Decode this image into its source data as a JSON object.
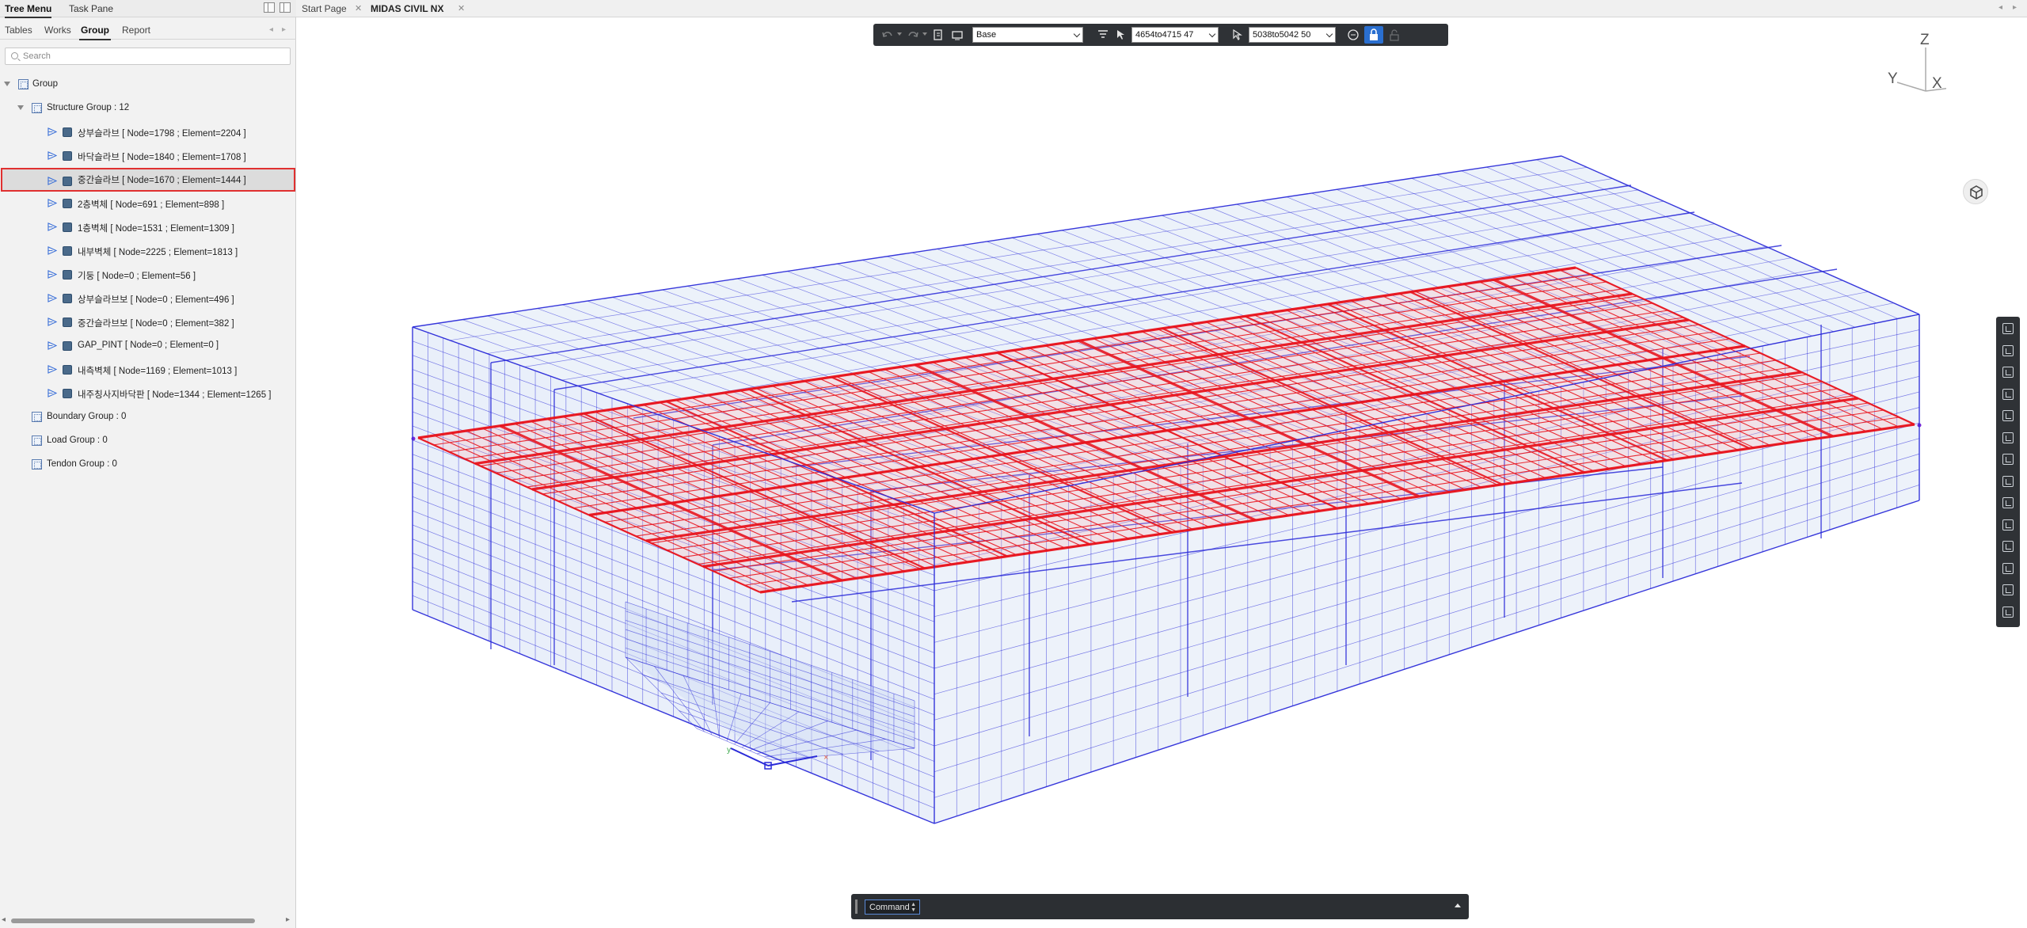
{
  "left_panel": {
    "tabs": [
      "Tree Menu",
      "Task Pane"
    ],
    "sub_tabs": [
      "Tables",
      "Works",
      "Group",
      "Report"
    ],
    "search": {
      "placeholder": "Search",
      "value": ""
    },
    "tree": {
      "root": "Group",
      "structure_group": "Structure Group : 12",
      "items": [
        "상부슬라브 [ Node=1798 ; Element=2204 ]",
        "바닥슬라브 [ Node=1840 ; Element=1708 ]",
        "중간슬라브 [ Node=1670 ; Element=1444 ]",
        "2층벽체 [ Node=691 ; Element=898 ]",
        "1층벽체 [ Node=1531 ; Element=1309 ]",
        "내부벽체 [ Node=2225 ; Element=1813 ]",
        "기둥 [ Node=0 ; Element=56 ]",
        "상부슬라브보 [ Node=0 ; Element=496 ]",
        "중간슬라브보 [ Node=0 ; Element=382 ]",
        "GAP_PINT [ Node=0 ; Element=0 ]",
        "내측벽체 [ Node=1169 ; Element=1013 ]",
        "내주칭사지바닥판 [ Node=1344 ; Element=1265 ]"
      ],
      "selected_index": 2,
      "other_groups": [
        "Boundary Group : 0",
        "Load Group : 0",
        "Tendon Group : 0"
      ]
    }
  },
  "doc_tabs": [
    "Start Page",
    "MIDAS CIVIL NX"
  ],
  "toolbar": {
    "view_select": "Base",
    "node_select": "4654to4715 47",
    "element_select": "5038to5042 50"
  },
  "axis": {
    "z": "Z",
    "y": "Y",
    "x": "X"
  },
  "command": {
    "label": "Command"
  },
  "colors": {
    "mesh": "#2a2ad8",
    "selected_mesh": "#e8141e",
    "selection_border": "#e03030",
    "toolbar_bg": "#2f3236",
    "active_blue": "#2a6fd0"
  },
  "icons": [
    "undo-icon",
    "redo-icon",
    "shrink-icon",
    "zoom-icon",
    "filter-icon",
    "select-node-icon",
    "select-element-icon",
    "chat-icon",
    "lock-icon",
    "unlock-icon",
    "view-cube-icon"
  ]
}
